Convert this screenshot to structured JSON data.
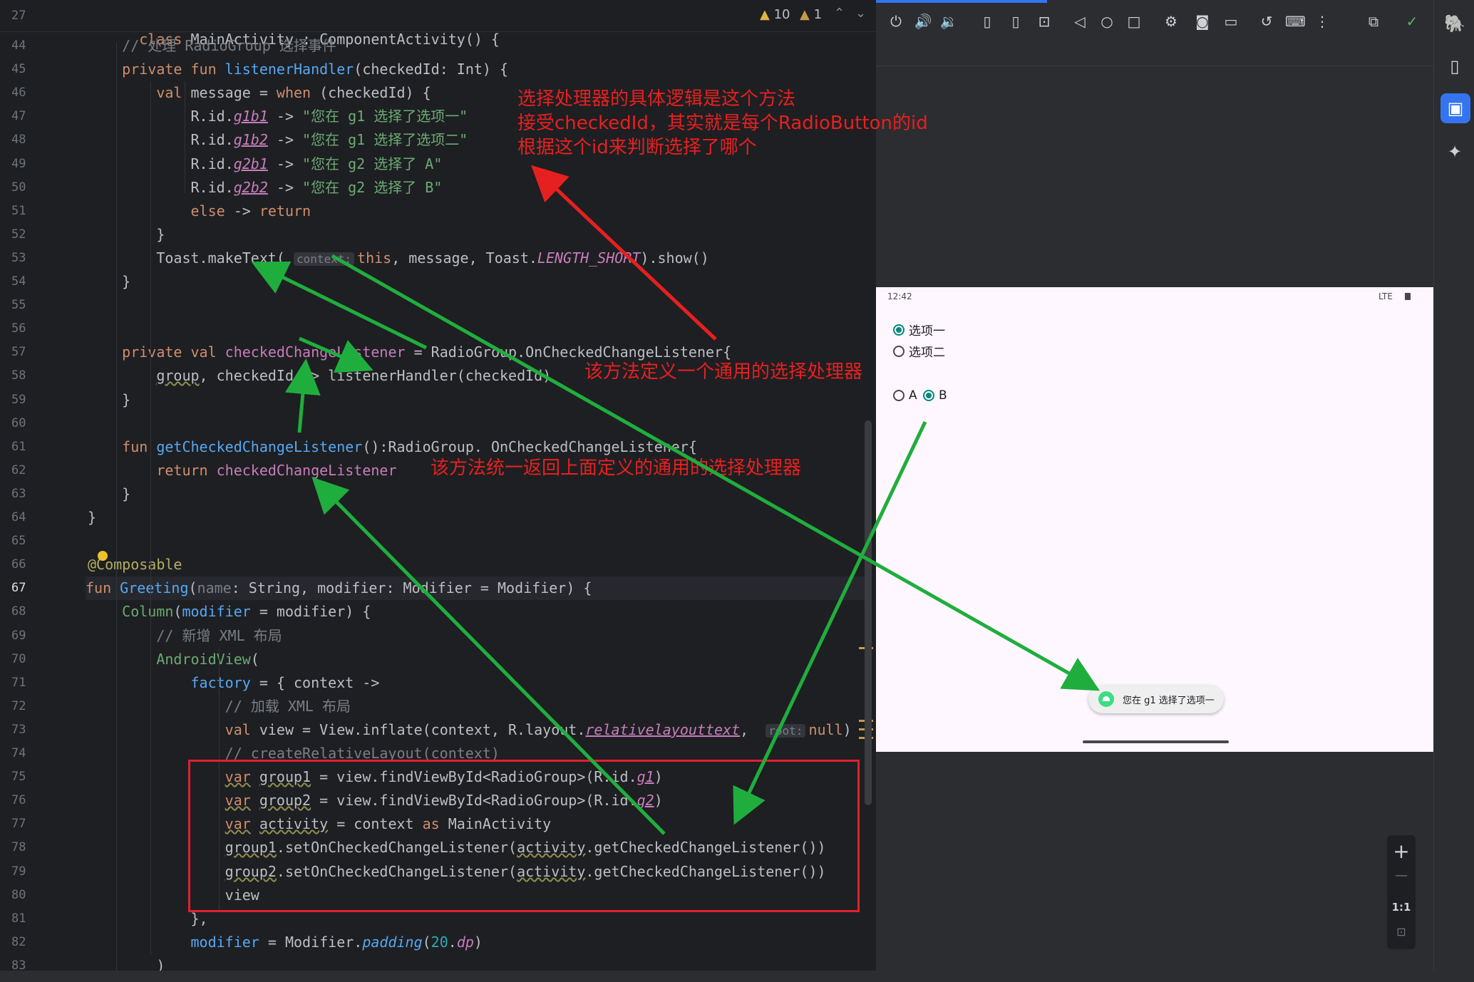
{
  "editor": {
    "header_line_number": "27",
    "header_code": "class MainActivity : ComponentActivity() {",
    "warnings_count": "10",
    "weak_warnings_count": "1",
    "lines": [
      {
        "n": "44",
        "parts": [
          {
            "t": "    "
          },
          {
            "t": "// 处理 RadioGroup 选择事件",
            "c": "cmt"
          }
        ]
      },
      {
        "n": "45",
        "parts": [
          {
            "t": "    "
          },
          {
            "t": "private fun ",
            "c": "kw"
          },
          {
            "t": "listenerHandler",
            "c": "fn"
          },
          {
            "t": "(checkedId: Int) {"
          }
        ]
      },
      {
        "n": "46",
        "parts": [
          {
            "t": "        "
          },
          {
            "t": "val ",
            "c": "kw"
          },
          {
            "t": "message = "
          },
          {
            "t": "when ",
            "c": "kw"
          },
          {
            "t": "(checkedId) {"
          }
        ]
      },
      {
        "n": "47",
        "parts": [
          {
            "t": "            R.id."
          },
          {
            "t": "g1b1",
            "c": "prop it ul"
          },
          {
            "t": " -> "
          },
          {
            "t": "\"您在 g1 选择了选项一\"",
            "c": "str"
          }
        ]
      },
      {
        "n": "48",
        "parts": [
          {
            "t": "            R.id."
          },
          {
            "t": "g1b2",
            "c": "prop it ul"
          },
          {
            "t": " -> "
          },
          {
            "t": "\"您在 g1 选择了选项二\"",
            "c": "str"
          }
        ]
      },
      {
        "n": "49",
        "parts": [
          {
            "t": "            R.id."
          },
          {
            "t": "g2b1",
            "c": "prop it ul"
          },
          {
            "t": " -> "
          },
          {
            "t": "\"您在 g2 选择了 A\"",
            "c": "str"
          }
        ]
      },
      {
        "n": "50",
        "parts": [
          {
            "t": "            R.id."
          },
          {
            "t": "g2b2",
            "c": "prop it ul"
          },
          {
            "t": " -> "
          },
          {
            "t": "\"您在 g2 选择了 B\"",
            "c": "str"
          }
        ]
      },
      {
        "n": "51",
        "parts": [
          {
            "t": "            "
          },
          {
            "t": "else ",
            "c": "kw"
          },
          {
            "t": "-> "
          },
          {
            "t": "return",
            "c": "kw"
          }
        ]
      },
      {
        "n": "52",
        "parts": [
          {
            "t": "        }"
          }
        ]
      },
      {
        "n": "53",
        "parts": [
          {
            "t": "        Toast.makeText( "
          },
          {
            "t": "context:",
            "c": "hint"
          },
          {
            "t": "this",
            "c": "kw"
          },
          {
            "t": ", message, Toast."
          },
          {
            "t": "LENGTH_SHORT",
            "c": "prop it"
          },
          {
            "t": ").show()"
          }
        ]
      },
      {
        "n": "54",
        "parts": [
          {
            "t": "    }"
          }
        ]
      },
      {
        "n": "55",
        "parts": []
      },
      {
        "n": "56",
        "parts": []
      },
      {
        "n": "57",
        "parts": [
          {
            "t": "    "
          },
          {
            "t": "private val ",
            "c": "kw"
          },
          {
            "t": "checkedChangeListener",
            "c": "prop"
          },
          {
            "t": " = RadioGroup.OnCheckedChangeListener{"
          }
        ]
      },
      {
        "n": "58",
        "parts": [
          {
            "t": "        "
          },
          {
            "t": "group",
            "c": "wav"
          },
          {
            "t": ", checkedId -> listenerHandler(checkedId)"
          }
        ]
      },
      {
        "n": "59",
        "parts": [
          {
            "t": "    }"
          }
        ]
      },
      {
        "n": "60",
        "parts": []
      },
      {
        "n": "61",
        "parts": [
          {
            "t": "    "
          },
          {
            "t": "fun ",
            "c": "kw"
          },
          {
            "t": "getCheckedChangeListener",
            "c": "fn"
          },
          {
            "t": "():RadioGroup. OnCheckedChangeListener{"
          }
        ]
      },
      {
        "n": "62",
        "parts": [
          {
            "t": "        "
          },
          {
            "t": "return ",
            "c": "kw"
          },
          {
            "t": "checkedChangeListener",
            "c": "prop"
          }
        ]
      },
      {
        "n": "63",
        "parts": [
          {
            "t": "    }"
          }
        ]
      },
      {
        "n": "64",
        "parts": [
          {
            "t": "}"
          }
        ]
      },
      {
        "n": "65",
        "parts": []
      },
      {
        "n": "66",
        "parts": [
          {
            "t": "@Composable",
            "c": "ann"
          }
        ]
      },
      {
        "n": "67",
        "parts": [
          {
            "t": "fun ",
            "c": "kw"
          },
          {
            "t": "Greeting",
            "c": "fn"
          },
          {
            "t": "("
          },
          {
            "t": "name",
            "c": "cmt"
          },
          {
            "t": ": String, modifier: Modifier = Modifier) {"
          }
        ]
      },
      {
        "n": "68",
        "parts": [
          {
            "t": "    "
          },
          {
            "t": "Column",
            "c": "str"
          },
          {
            "t": "("
          },
          {
            "t": "modifier",
            "c": "param"
          },
          {
            "t": " = modifier) {"
          }
        ]
      },
      {
        "n": "69",
        "parts": [
          {
            "t": "        "
          },
          {
            "t": "// 新增 XML 布局",
            "c": "cmt"
          }
        ]
      },
      {
        "n": "70",
        "parts": [
          {
            "t": "        "
          },
          {
            "t": "AndroidView",
            "c": "str"
          },
          {
            "t": "("
          }
        ]
      },
      {
        "n": "71",
        "parts": [
          {
            "t": "            "
          },
          {
            "t": "factory",
            "c": "param"
          },
          {
            "t": " = { context ->"
          }
        ]
      },
      {
        "n": "72",
        "parts": [
          {
            "t": "                "
          },
          {
            "t": "// 加载 XML 布局",
            "c": "cmt"
          }
        ]
      },
      {
        "n": "73",
        "parts": [
          {
            "t": "                "
          },
          {
            "t": "val ",
            "c": "kw"
          },
          {
            "t": "view = View.inflate(context, R.layout."
          },
          {
            "t": "relativelayouttext",
            "c": "prop it ul"
          },
          {
            "t": ",  "
          },
          {
            "t": "root:",
            "c": "hint"
          },
          {
            "t": "null",
            "c": "kw"
          },
          {
            "t": ")"
          }
        ]
      },
      {
        "n": "74",
        "parts": [
          {
            "t": "                "
          },
          {
            "t": "// createRelativeLayout(context)",
            "c": "cmt"
          }
        ]
      },
      {
        "n": "75",
        "parts": [
          {
            "t": "                "
          },
          {
            "t": "var",
            "c": "kw wav"
          },
          {
            "t": " "
          },
          {
            "t": "group1",
            "c": "wav"
          },
          {
            "t": " = view.findViewById<RadioGroup>(R.id."
          },
          {
            "t": "g1",
            "c": "prop it ul"
          },
          {
            "t": ")"
          }
        ]
      },
      {
        "n": "76",
        "parts": [
          {
            "t": "                "
          },
          {
            "t": "var",
            "c": "kw wav"
          },
          {
            "t": " "
          },
          {
            "t": "group2",
            "c": "wav"
          },
          {
            "t": " = view.findViewById<RadioGroup>(R.id."
          },
          {
            "t": "g2",
            "c": "prop it ul"
          },
          {
            "t": ")"
          }
        ]
      },
      {
        "n": "77",
        "parts": [
          {
            "t": "                "
          },
          {
            "t": "var",
            "c": "kw wav"
          },
          {
            "t": " "
          },
          {
            "t": "activity",
            "c": "wav"
          },
          {
            "t": " = context "
          },
          {
            "t": "as ",
            "c": "kw"
          },
          {
            "t": "MainActivity"
          }
        ]
      },
      {
        "n": "78",
        "parts": [
          {
            "t": "                "
          },
          {
            "t": "group1",
            "c": "wav"
          },
          {
            "t": ".setOnCheckedChangeListener("
          },
          {
            "t": "activity",
            "c": "wav"
          },
          {
            "t": ".getCheckedChangeListener())"
          }
        ]
      },
      {
        "n": "79",
        "parts": [
          {
            "t": "                "
          },
          {
            "t": "group2",
            "c": "wav"
          },
          {
            "t": ".setOnCheckedChangeListener("
          },
          {
            "t": "activity",
            "c": "wav"
          },
          {
            "t": ".getCheckedChangeListener())"
          }
        ]
      },
      {
        "n": "80",
        "parts": [
          {
            "t": "                view"
          }
        ]
      },
      {
        "n": "81",
        "parts": [
          {
            "t": "            },"
          }
        ]
      },
      {
        "n": "82",
        "parts": [
          {
            "t": "            "
          },
          {
            "t": "modifier",
            "c": "param"
          },
          {
            "t": " = Modifier."
          },
          {
            "t": "padding",
            "c": "fn it"
          },
          {
            "t": "("
          },
          {
            "t": "20",
            "c": "num"
          },
          {
            "t": "."
          },
          {
            "t": "dp",
            "c": "prop it"
          },
          {
            "t": ")"
          }
        ]
      },
      {
        "n": "83",
        "parts": [
          {
            "t": "        )"
          }
        ]
      }
    ]
  },
  "annotations": {
    "top": "选择处理器的具体逻辑是这个方法\n接受checkedId，其实就是每个RadioButton的id\n根据这个id来判断选择了哪个",
    "middle": "该方法定义一个通用的选择处理器",
    "lower": "该方法统一返回上面定义的通用的选择处理器"
  },
  "phone": {
    "time": "12:42",
    "network": "LTE",
    "group1_options": [
      "选项一",
      "选项二"
    ],
    "group1_selected": 0,
    "group2_options": [
      "A",
      "B"
    ],
    "group2_selected": 1,
    "toast_text": "您在 g1 选择了选项一"
  },
  "zoom": {
    "plus": "+",
    "minus": "—",
    "ratio": "1:1"
  },
  "colors": {
    "annotation_red": "#e62020",
    "arrow_green": "#1fae3d",
    "accent": "#3574f0",
    "radio_selected": "#00897b"
  }
}
